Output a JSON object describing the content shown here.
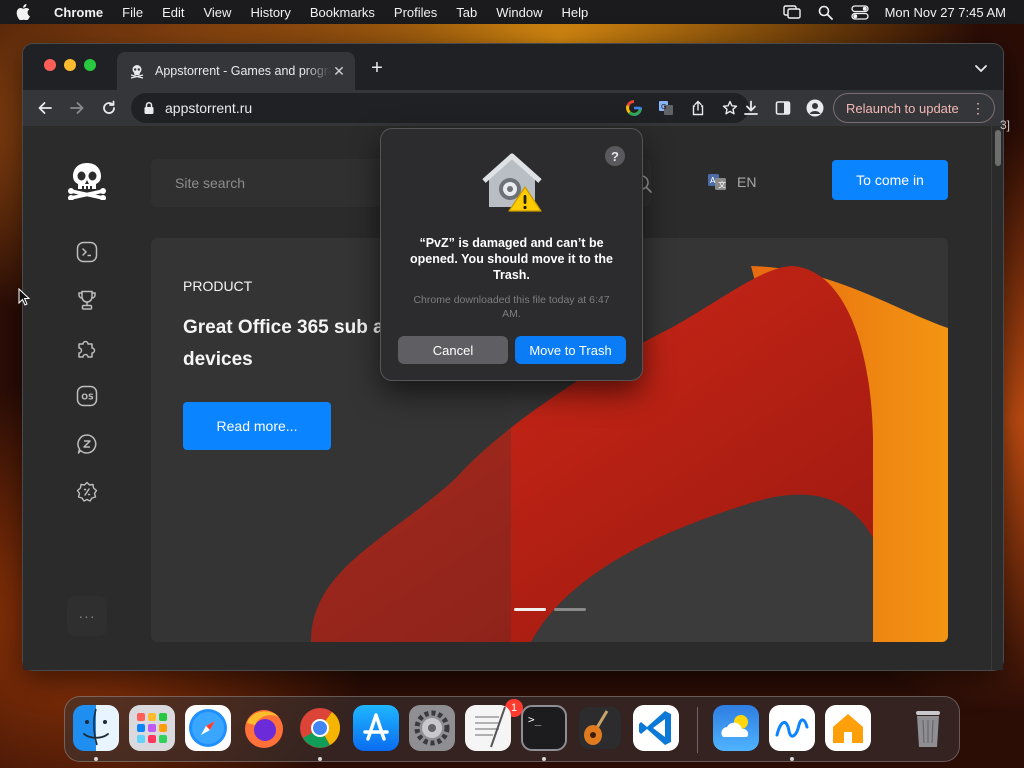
{
  "menubar": {
    "app": "Chrome",
    "items": [
      "File",
      "Edit",
      "View",
      "History",
      "Bookmarks",
      "Profiles",
      "Tab",
      "Window",
      "Help"
    ],
    "clock": "Mon Nov 27  7:45 AM"
  },
  "browser": {
    "tab_title": "Appstorrent - Games and programs",
    "url": "appstorrent.ru",
    "relaunch_label": "Relaunch to update",
    "relaunch_more": "⋮"
  },
  "site": {
    "search_placeholder": "Site search",
    "language": "EN",
    "login_label": "To come in",
    "sidebar_more": "···",
    "banner": {
      "tag": "PRODUCT",
      "title": "Great Office 365 sub all your devices",
      "read_more": "Read more..."
    }
  },
  "dialog": {
    "help": "?",
    "message": "“PvZ” is damaged and can’t be opened. You should move it to the Trash.",
    "info": "Chrome downloaded this file today at 6:47 AM.",
    "cancel_label": "Cancel",
    "confirm_label": "Move to Trash"
  },
  "dock": {
    "badge_count": "1"
  },
  "peek_text": "3]",
  "colors": {
    "accent": "#0a84ff",
    "relaunch_text": "#f2b8b5",
    "banner_red": "#b01e12",
    "banner_orange": "#f07f0c"
  }
}
